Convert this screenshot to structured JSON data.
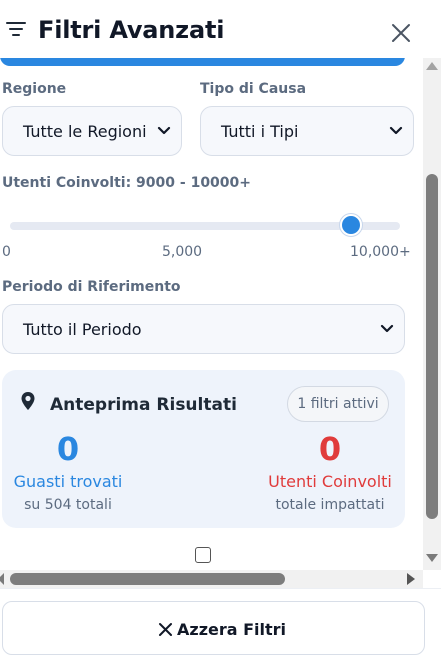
{
  "header": {
    "title": "Filtri Avanzati"
  },
  "filters": {
    "region": {
      "label": "Regione",
      "value": "Tutte le Regioni"
    },
    "cause_type": {
      "label": "Tipo di Causa",
      "value": "Tutti i Tipi"
    },
    "users": {
      "label": "Utenti Coinvolti: 9000 - 10000+",
      "range_min": 9000,
      "range_max": 10000,
      "ticks": [
        "0",
        "5,000",
        "10,000+"
      ]
    },
    "period": {
      "label": "Periodo di Riferimento",
      "value": "Tutto il Periodo"
    }
  },
  "preview": {
    "title": "Anteprima Risultati",
    "badge": "1 filtri attivi",
    "faults": {
      "value": "0",
      "label": "Guasti trovati",
      "sub": "su 504 totali"
    },
    "users": {
      "value": "0",
      "label": "Utenti Coinvolti",
      "sub": "totale impattati"
    }
  },
  "footer": {
    "reset_label": "Azzera Filtri"
  },
  "colors": {
    "accent": "#2a87e0",
    "danger": "#e03b3b",
    "card_bg": "#eef3fb",
    "label": "#5c6b80"
  },
  "icons": {
    "menu": "filter-lines-icon",
    "close": "close-icon",
    "pin": "map-pin-icon",
    "reset": "close-icon"
  }
}
